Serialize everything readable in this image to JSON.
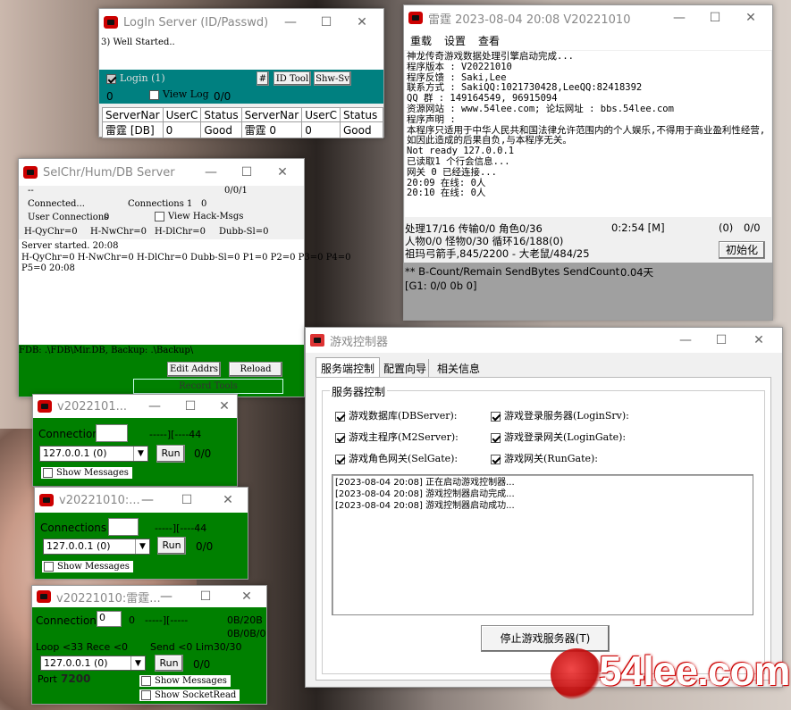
{
  "login_win": {
    "title": "LogIn Server (ID/Passwd)",
    "log": "3) Well Started..",
    "login_label": "Login (1)",
    "hash_btn": "#",
    "id_tool": "ID Tool",
    "shw_sv": "Shw-Sv",
    "count": "0",
    "view_log": "View Log",
    "ratio": "0/0",
    "headers": [
      "ServerNar",
      "UserC",
      "Status",
      "ServerNar",
      "UserC",
      "Status"
    ],
    "row": [
      "雷霆 [DB]",
      "0",
      "Good",
      "雷霆 0",
      "0",
      "Good"
    ]
  },
  "main_win": {
    "title": "雷霆 2023-08-04 20:08 V20221010",
    "menu": [
      "重载",
      "设置",
      "查看"
    ],
    "log": [
      "神龙传奇游戏数据处理引擎启动完成...",
      "程序版本 : V20221010",
      "程序反馈 : Saki,Lee",
      "联系方式 : SakiQQ:1021730428,LeeQQ:82418392",
      "QQ    群 : 149164549, 96915094",
      "资源网站 : www.54lee.com; 论坛网址 : bbs.54lee.com",
      "程序声明 :",
      "本程序只适用于中华人民共和国法律允许范围内的个人娱乐,不得用于商业盈利性经营,如因此造成的后果自负,与本程序无关。",
      "Not ready 127.0.0.1",
      "已读取1 个行会信息...",
      "网关 0 已经连接...",
      "20:09 在线: 0人",
      "20:10 在线: 0人"
    ],
    "status1": "处理17/16 传输0/0 角色0/36",
    "time": "0:2:54 [M]",
    "zero": "(0)",
    "ratio": "0/0",
    "status2": "人物0/0 怪物0/30 循环16/188(0)",
    "status3": "祖玛弓箭手,845/2200 - 大老鼠/484/25",
    "init_btn": "初始化",
    "send_line": "** B-Count/Remain SendBytes SendCount",
    "days": "0.04天",
    "g1": "[G1: 0/0 0b 0]"
  },
  "selchr_win": {
    "title": "SelChr/Hum/DB Server",
    "dash": "--",
    "ratio": "0/0/1",
    "connected": "Connected...",
    "connections": "Connections 1",
    "conn_val": "0",
    "user_conn": "User Connections",
    "user_conn_val": "0",
    "view_hack": "View Hack-Msgs",
    "h_qy": "H-QyChr=0",
    "h_nw": "H-NwChr=0",
    "h_dl": "H-DlChr=0",
    "dubb": "Dubb-Sl=0",
    "log": [
      "Server started. 20:08",
      "H-QyChr=0 H-NwChr=0 H-DlChr=0 Dubb-Sl=0 P1=0 P2=0 P3=0 P4=0",
      "P5=0 20:08"
    ],
    "fdb": "FDB: .\\FDB\\Mir.DB, Backup: .\\Backup\\",
    "edit_btn": "Edit Addrs",
    "reload_btn": "Reload Addr",
    "record_btn": "Record Tools"
  },
  "gate1": {
    "title": "v2022101...",
    "connection": "Connection",
    "dash": "-----][----44",
    "select": "127.0.0.1  (0)",
    "run": "Run",
    "ratio": "0/0",
    "show": "Show Messages"
  },
  "gate2": {
    "title": "v20221010:...",
    "connections": "Connections",
    "dash": "-----][----44",
    "select": "127.0.0.1  (0)",
    "run": "Run",
    "ratio": "0/0",
    "show": "Show Messages"
  },
  "gate3": {
    "title": "v20221010:雷霆...",
    "connection": "Connection",
    "conn_val": "0",
    "zero": "0",
    "dash": "-----][-----",
    "bytes1": "0B/20B",
    "bytes2": "0B/0B/0",
    "loop": "Loop <33  Rece <0",
    "send": "Send <0 Lim30/30",
    "select": "127.0.0.1  (0)",
    "run": "Run",
    "ratio": "0/0",
    "port_label": "Port",
    "port": "7200",
    "show": "Show Messages",
    "show_sock": "Show SocketRead"
  },
  "ctrl_win": {
    "title": "游戏控制器",
    "tabs": [
      "服务端控制",
      "配置向导",
      "相关信息"
    ],
    "group": "服务器控制",
    "checks": [
      "游戏数据库(DBServer):",
      "游戏登录服务器(LoginSrv):",
      "游戏主程序(M2Server):",
      "游戏登录网关(LoginGate):",
      "游戏角色网关(SelGate):",
      "游戏网关(RunGate):"
    ],
    "log": [
      "[2023-08-04 20:08] 正在启动游戏控制器...",
      "[2023-08-04 20:08] 游戏控制器启动完成...",
      "[2023-08-04 20:08] 游戏控制器启动成功..."
    ],
    "stop_btn": "停止游戏服务器(T)"
  },
  "watermark": "54lee.com",
  "colors": {
    "green": "#008000",
    "teal": "#008080",
    "brand": "#cc0000"
  }
}
